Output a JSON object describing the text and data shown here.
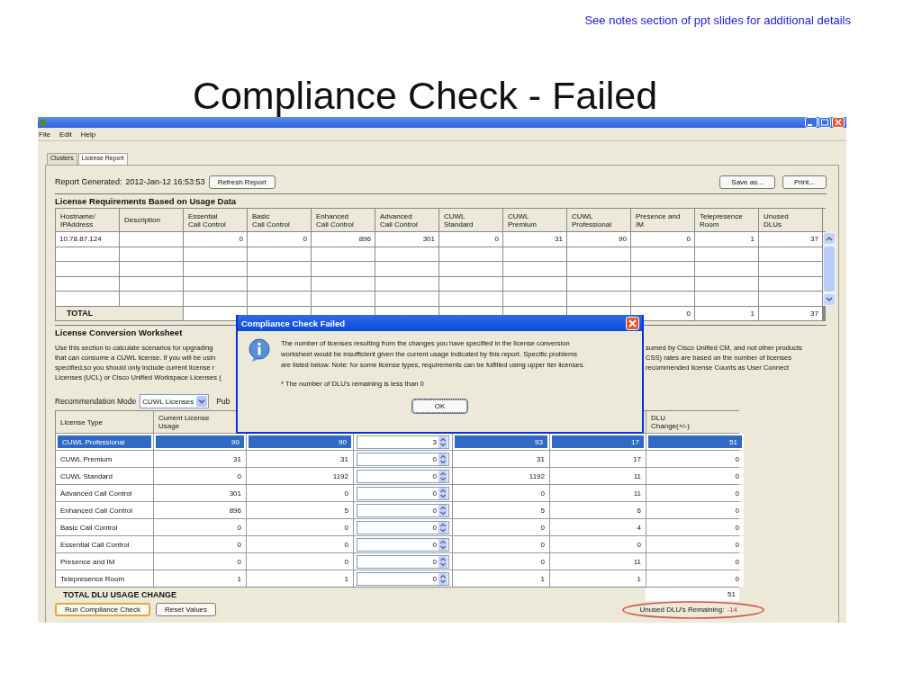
{
  "slide": {
    "note": "See notes section of ppt slides for additional details",
    "title": "Compliance Check - Failed"
  },
  "app": {
    "menu": [
      "File",
      "Edit",
      "Help"
    ],
    "tabs": [
      {
        "label": "Clusters",
        "selected": false
      },
      {
        "label": "License Report",
        "selected": true
      }
    ],
    "report": {
      "label": "Report Generated:",
      "timestamp": "2012-Jan-12 16:53:53",
      "refresh": "Refresh Report",
      "buttons": [
        "Save as...",
        "Print..."
      ]
    },
    "requirements": {
      "heading": "License Requirements Based on Usage Data",
      "columns": [
        "Hostname/\nIPAddress",
        "Description",
        "Essential\nCall Control",
        "Basic\nCall Control",
        "Enhanced\nCall Control",
        "Advanced\nCall Control",
        "CUWL\nStandard",
        "CUWL\nPremium",
        "CUWL\nProfessional",
        "Presence and\nIM",
        "Telepresence\nRoom",
        "Unused\nDLUs"
      ],
      "rows": [
        {
          "cells": [
            "10.78.87.124",
            null,
            "0",
            "0",
            "896",
            "301",
            "0",
            "31",
            "90",
            "0",
            "1",
            "37"
          ]
        }
      ],
      "total": {
        "label": "TOTAL",
        "values": [
          "0",
          "1",
          "37"
        ]
      }
    },
    "worksheet": {
      "heading": "License Conversion Worksheet",
      "lines": [
        {
          "left": "Use this section to calculate scenarios for upgrading",
          "right": "sumed by Cisco Unified CM, and not other products"
        },
        {
          "left": "that can consume a CUWL license. If you will be usin",
          "right": "CSS) rates are based on the number of licenses"
        },
        {
          "left": "specified,so you should only include current license r",
          "right": "recommended license Counts as User Connect"
        },
        {
          "left": "Licenses (UCL) or Cisco Unified Workspace Licenses ("
        }
      ],
      "mode_label": "Recommendation Mode",
      "mode_value": "CUWL Licenses",
      "partial_label": "Pub",
      "columns": [
        "License Type",
        "Current License\nUsage",
        null,
        null,
        null,
        null,
        "DLU\nChange(+/-)"
      ],
      "rows": [
        {
          "selected": true,
          "cells": [
            "CUWL Professional",
            "90",
            "90",
            "3",
            "93",
            "17",
            "51"
          ]
        },
        {
          "selected": false,
          "cells": [
            "CUWL Premium",
            "31",
            "31",
            "0",
            "31",
            "17",
            "0"
          ]
        },
        {
          "selected": false,
          "cells": [
            "CUWL Standard",
            "0",
            "1192",
            "0",
            "1192",
            "11",
            "0"
          ]
        },
        {
          "selected": false,
          "cells": [
            "Advanced Call Control",
            "301",
            "0",
            "0",
            "0",
            "11",
            "0"
          ]
        },
        {
          "selected": false,
          "cells": [
            "Enhanced Call Control",
            "896",
            "5",
            "0",
            "5",
            "6",
            "0"
          ]
        },
        {
          "selected": false,
          "cells": [
            "Basic Call Control",
            "0",
            "0",
            "0",
            "0",
            "4",
            "0"
          ]
        },
        {
          "selected": false,
          "cells": [
            "Essential Call Control",
            "0",
            "0",
            "0",
            "0",
            "0",
            "0"
          ]
        },
        {
          "selected": false,
          "cells": [
            "Presence and IM",
            "0",
            "0",
            "0",
            "0",
            "11",
            "0"
          ]
        },
        {
          "selected": false,
          "cells": [
            "Telepresence Room",
            "1",
            "1",
            "0",
            "1",
            "1",
            "0"
          ]
        }
      ],
      "total_label": "TOTAL DLU USAGE CHANGE",
      "total_value": "51",
      "buttons": [
        {
          "label": "Run Compliance Check",
          "focused": true
        },
        {
          "label": "Reset Values",
          "focused": false
        }
      ],
      "remaining_label": "Unused DLU's Remaining:",
      "remaining_value": "-14"
    },
    "dialog": {
      "title": "Compliance Check Failed",
      "message": "The number of licenses resulting from the changes you have specified in the license conversion\n worksheet would be insufficient given the current usage indicated by this report. Specific problems\n are listed below. Note: for some license types, requirements can be fulfilled using upper tier licenses.",
      "detail": "* The number of DLU's remaining is less than 0",
      "button": "OK"
    }
  }
}
